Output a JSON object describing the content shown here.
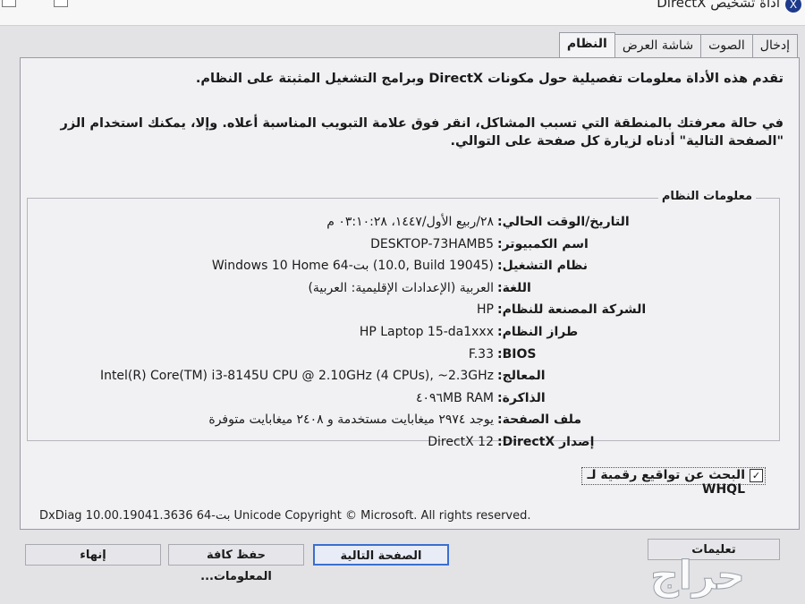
{
  "window": {
    "title": "أداة تشخيص DirectX",
    "app_icon_symbol": "X"
  },
  "tabs": [
    {
      "label": "النظام",
      "active": true
    },
    {
      "label": "شاشة العرض",
      "active": false
    },
    {
      "label": "الصوت",
      "active": false
    },
    {
      "label": "إدخال",
      "active": false
    }
  ],
  "intro": {
    "line1": "تقدم هذه الأداة معلومات تفصيلية حول مكونات DirectX وبرامج التشغيل المثبتة على النظام.",
    "line2": "في حالة معرفتك بالمنطقة التي تسبب المشاكل، انقر فوق علامة التبويب المناسبة أعلاه. وإلا، يمكنك استخدام الزر \"الصفحة التالية\" أدناه لزيارة كل صفحة على التوالي."
  },
  "system_info": {
    "group_title": "معلومات النظام",
    "rows": [
      {
        "label": "التاريخ/الوقت الحالي:",
        "value": "٢٨/ربيع الأول/١٤٤٧، ٠٣:١٠:٢٨ م"
      },
      {
        "label": "اسم الكمبيوتر:",
        "value": "DESKTOP-73HAMB5"
      },
      {
        "label": "نظام التشغيل:",
        "value": "Windows 10 Home 64-بت (10.0, Build 19045)"
      },
      {
        "label": "اللغة:",
        "value": "العربية (الإعدادات الإقليمية: العربية)"
      },
      {
        "label": "الشركة المصنعة للنظام:",
        "value": "HP"
      },
      {
        "label": "طراز النظام:",
        "value": "HP Laptop 15-da1xxx"
      },
      {
        "label": "BIOS:",
        "value": "F.33"
      },
      {
        "label": "المعالج:",
        "value": "Intel(R) Core(TM) i3-8145U CPU @ 2.10GHz (4 CPUs), ~2.3GHz"
      },
      {
        "label": "الذاكرة:",
        "value": "٤٠٩٦MB RAM"
      },
      {
        "label": "ملف الصفحة:",
        "value": "يوجد ٢٩٧٤ ميغابايت مستخدمة و ٢٤٠٨ ميغابايت متوفرة"
      },
      {
        "label": "إصدار DirectX:",
        "value": "DirectX 12"
      }
    ]
  },
  "whql": {
    "label": "البحث عن تواقيع رقمية لـ WHQL",
    "checked": true,
    "check_glyph": "✓"
  },
  "copyright": "DxDiag 10.00.19041.3636 64-بت Unicode  Copyright © Microsoft. All rights reserved.",
  "buttons": {
    "help": "تعليمات",
    "next_page": "الصفحة التالية",
    "save_all": "حفظ كافة المعلومات...",
    "exit": "إنهاء"
  },
  "watermark": {
    "text": "حراج",
    "color": "#ffffff"
  },
  "colors": {
    "focus_border": "#3a6fd0",
    "panel_bg": "#f1f1f4"
  }
}
